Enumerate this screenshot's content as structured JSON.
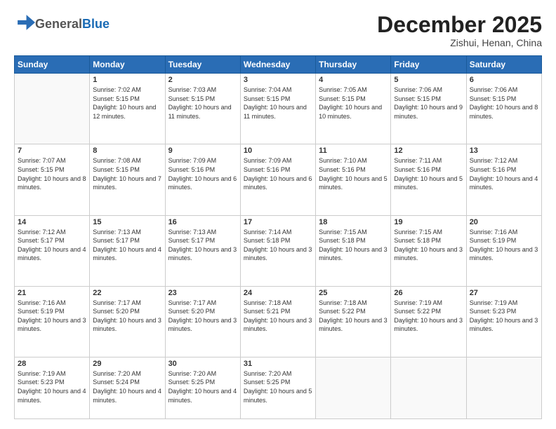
{
  "header": {
    "logo_general": "General",
    "logo_blue": "Blue",
    "month_title": "December 2025",
    "location": "Zishui, Henan, China"
  },
  "days_of_week": [
    "Sunday",
    "Monday",
    "Tuesday",
    "Wednesday",
    "Thursday",
    "Friday",
    "Saturday"
  ],
  "weeks": [
    [
      {
        "num": "",
        "sunrise": "",
        "sunset": "",
        "daylight": ""
      },
      {
        "num": "1",
        "sunrise": "Sunrise: 7:02 AM",
        "sunset": "Sunset: 5:15 PM",
        "daylight": "Daylight: 10 hours and 12 minutes."
      },
      {
        "num": "2",
        "sunrise": "Sunrise: 7:03 AM",
        "sunset": "Sunset: 5:15 PM",
        "daylight": "Daylight: 10 hours and 11 minutes."
      },
      {
        "num": "3",
        "sunrise": "Sunrise: 7:04 AM",
        "sunset": "Sunset: 5:15 PM",
        "daylight": "Daylight: 10 hours and 11 minutes."
      },
      {
        "num": "4",
        "sunrise": "Sunrise: 7:05 AM",
        "sunset": "Sunset: 5:15 PM",
        "daylight": "Daylight: 10 hours and 10 minutes."
      },
      {
        "num": "5",
        "sunrise": "Sunrise: 7:06 AM",
        "sunset": "Sunset: 5:15 PM",
        "daylight": "Daylight: 10 hours and 9 minutes."
      },
      {
        "num": "6",
        "sunrise": "Sunrise: 7:06 AM",
        "sunset": "Sunset: 5:15 PM",
        "daylight": "Daylight: 10 hours and 8 minutes."
      }
    ],
    [
      {
        "num": "7",
        "sunrise": "Sunrise: 7:07 AM",
        "sunset": "Sunset: 5:15 PM",
        "daylight": "Daylight: 10 hours and 8 minutes."
      },
      {
        "num": "8",
        "sunrise": "Sunrise: 7:08 AM",
        "sunset": "Sunset: 5:15 PM",
        "daylight": "Daylight: 10 hours and 7 minutes."
      },
      {
        "num": "9",
        "sunrise": "Sunrise: 7:09 AM",
        "sunset": "Sunset: 5:16 PM",
        "daylight": "Daylight: 10 hours and 6 minutes."
      },
      {
        "num": "10",
        "sunrise": "Sunrise: 7:09 AM",
        "sunset": "Sunset: 5:16 PM",
        "daylight": "Daylight: 10 hours and 6 minutes."
      },
      {
        "num": "11",
        "sunrise": "Sunrise: 7:10 AM",
        "sunset": "Sunset: 5:16 PM",
        "daylight": "Daylight: 10 hours and 5 minutes."
      },
      {
        "num": "12",
        "sunrise": "Sunrise: 7:11 AM",
        "sunset": "Sunset: 5:16 PM",
        "daylight": "Daylight: 10 hours and 5 minutes."
      },
      {
        "num": "13",
        "sunrise": "Sunrise: 7:12 AM",
        "sunset": "Sunset: 5:16 PM",
        "daylight": "Daylight: 10 hours and 4 minutes."
      }
    ],
    [
      {
        "num": "14",
        "sunrise": "Sunrise: 7:12 AM",
        "sunset": "Sunset: 5:17 PM",
        "daylight": "Daylight: 10 hours and 4 minutes."
      },
      {
        "num": "15",
        "sunrise": "Sunrise: 7:13 AM",
        "sunset": "Sunset: 5:17 PM",
        "daylight": "Daylight: 10 hours and 4 minutes."
      },
      {
        "num": "16",
        "sunrise": "Sunrise: 7:13 AM",
        "sunset": "Sunset: 5:17 PM",
        "daylight": "Daylight: 10 hours and 3 minutes."
      },
      {
        "num": "17",
        "sunrise": "Sunrise: 7:14 AM",
        "sunset": "Sunset: 5:18 PM",
        "daylight": "Daylight: 10 hours and 3 minutes."
      },
      {
        "num": "18",
        "sunrise": "Sunrise: 7:15 AM",
        "sunset": "Sunset: 5:18 PM",
        "daylight": "Daylight: 10 hours and 3 minutes."
      },
      {
        "num": "19",
        "sunrise": "Sunrise: 7:15 AM",
        "sunset": "Sunset: 5:18 PM",
        "daylight": "Daylight: 10 hours and 3 minutes."
      },
      {
        "num": "20",
        "sunrise": "Sunrise: 7:16 AM",
        "sunset": "Sunset: 5:19 PM",
        "daylight": "Daylight: 10 hours and 3 minutes."
      }
    ],
    [
      {
        "num": "21",
        "sunrise": "Sunrise: 7:16 AM",
        "sunset": "Sunset: 5:19 PM",
        "daylight": "Daylight: 10 hours and 3 minutes."
      },
      {
        "num": "22",
        "sunrise": "Sunrise: 7:17 AM",
        "sunset": "Sunset: 5:20 PM",
        "daylight": "Daylight: 10 hours and 3 minutes."
      },
      {
        "num": "23",
        "sunrise": "Sunrise: 7:17 AM",
        "sunset": "Sunset: 5:20 PM",
        "daylight": "Daylight: 10 hours and 3 minutes."
      },
      {
        "num": "24",
        "sunrise": "Sunrise: 7:18 AM",
        "sunset": "Sunset: 5:21 PM",
        "daylight": "Daylight: 10 hours and 3 minutes."
      },
      {
        "num": "25",
        "sunrise": "Sunrise: 7:18 AM",
        "sunset": "Sunset: 5:22 PM",
        "daylight": "Daylight: 10 hours and 3 minutes."
      },
      {
        "num": "26",
        "sunrise": "Sunrise: 7:19 AM",
        "sunset": "Sunset: 5:22 PM",
        "daylight": "Daylight: 10 hours and 3 minutes."
      },
      {
        "num": "27",
        "sunrise": "Sunrise: 7:19 AM",
        "sunset": "Sunset: 5:23 PM",
        "daylight": "Daylight: 10 hours and 3 minutes."
      }
    ],
    [
      {
        "num": "28",
        "sunrise": "Sunrise: 7:19 AM",
        "sunset": "Sunset: 5:23 PM",
        "daylight": "Daylight: 10 hours and 4 minutes."
      },
      {
        "num": "29",
        "sunrise": "Sunrise: 7:20 AM",
        "sunset": "Sunset: 5:24 PM",
        "daylight": "Daylight: 10 hours and 4 minutes."
      },
      {
        "num": "30",
        "sunrise": "Sunrise: 7:20 AM",
        "sunset": "Sunset: 5:25 PM",
        "daylight": "Daylight: 10 hours and 4 minutes."
      },
      {
        "num": "31",
        "sunrise": "Sunrise: 7:20 AM",
        "sunset": "Sunset: 5:25 PM",
        "daylight": "Daylight: 10 hours and 5 minutes."
      },
      {
        "num": "",
        "sunrise": "",
        "sunset": "",
        "daylight": ""
      },
      {
        "num": "",
        "sunrise": "",
        "sunset": "",
        "daylight": ""
      },
      {
        "num": "",
        "sunrise": "",
        "sunset": "",
        "daylight": ""
      }
    ]
  ]
}
